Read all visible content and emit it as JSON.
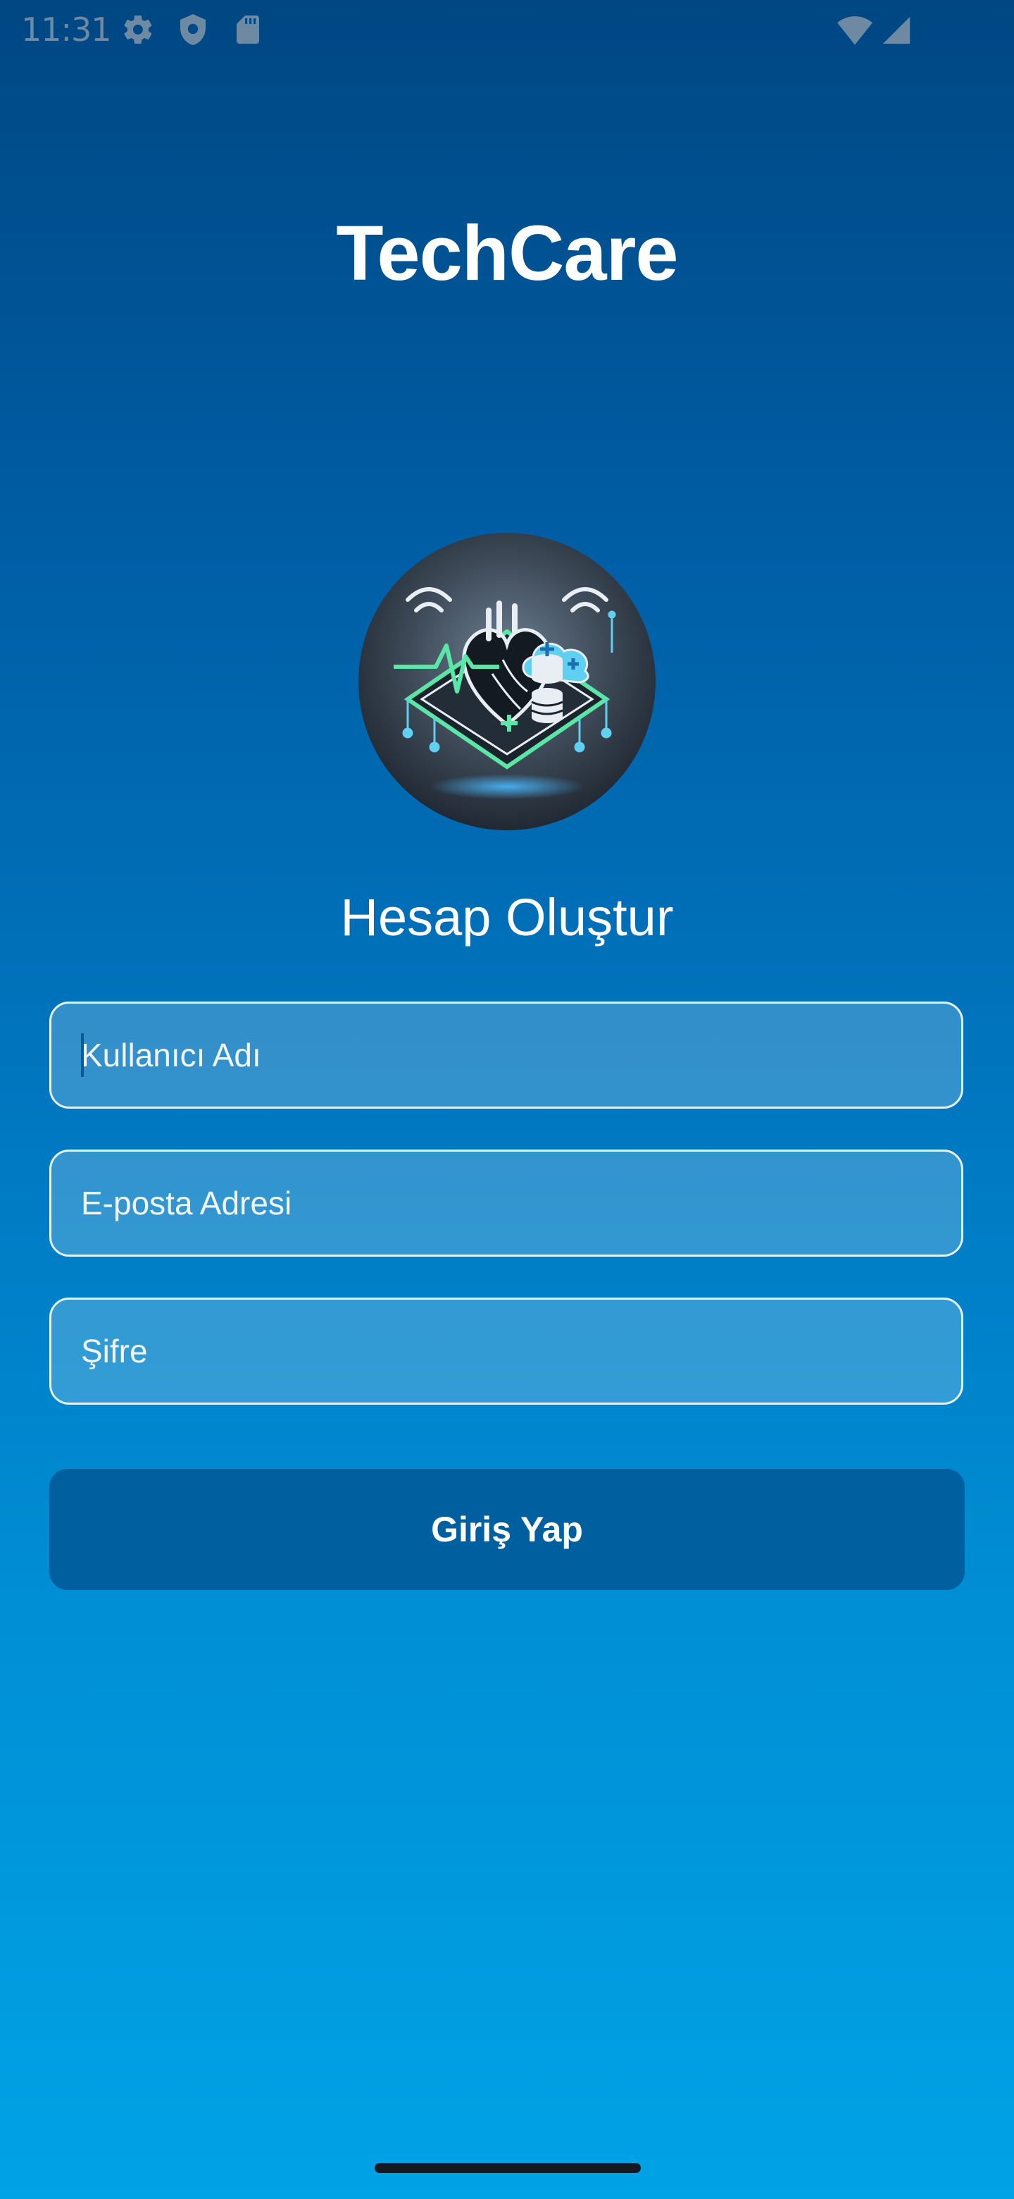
{
  "status_bar": {
    "time": "11:31",
    "left_icons": [
      "gear-icon",
      "shield-icon",
      "sd-card-icon"
    ],
    "right_icons": [
      "wifi-icon",
      "cellular-signal-icon"
    ]
  },
  "header": {
    "app_title": "TechCare"
  },
  "logo": {
    "icon": "health-tech-heart-logo"
  },
  "form": {
    "heading": "Hesap Oluştur",
    "username": {
      "placeholder": "Kullanıcı Adı",
      "value": ""
    },
    "email": {
      "placeholder": "E-posta Adresi",
      "value": ""
    },
    "password": {
      "placeholder": "Şifre",
      "value": ""
    },
    "submit_label": "Giriş Yap"
  },
  "colors": {
    "gradient_top": "#004783",
    "gradient_bottom": "#00a3e6",
    "button": "#00609f",
    "field_border": "#e6f2fa",
    "accent_green": "#5be6a8",
    "accent_cyan": "#5fd0f0"
  }
}
